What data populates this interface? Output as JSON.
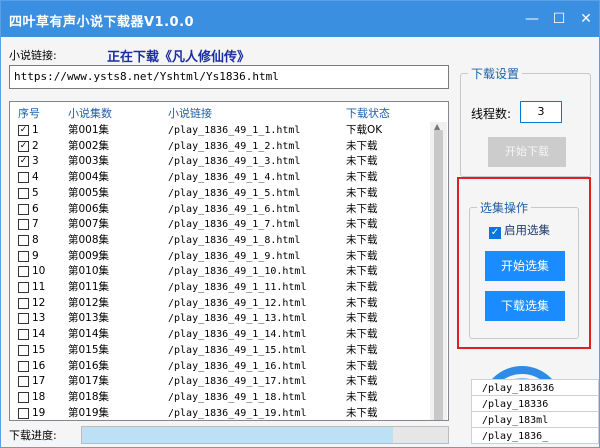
{
  "app": {
    "title": "四叶草有声小说下载器V1.0.0"
  },
  "window_controls": {
    "minimize": "—",
    "maximize": "☐",
    "close": "✕"
  },
  "link": {
    "label": "小说链接:",
    "status": "正在下载《凡人修仙传》",
    "url": "https://www.ysts8.net/Yshtml/Ys1836.html"
  },
  "table": {
    "headers": [
      "序号",
      "小说集数",
      "小说链接",
      "下载状态"
    ],
    "rows": [
      {
        "checked": true,
        "no": "1",
        "ep": "第001集",
        "link": "/play_1836_49_1_1.html",
        "status": "下载OK"
      },
      {
        "checked": true,
        "no": "2",
        "ep": "第002集",
        "link": "/play_1836_49_1_2.html",
        "status": "未下载"
      },
      {
        "checked": true,
        "no": "3",
        "ep": "第003集",
        "link": "/play_1836_49_1_3.html",
        "status": "未下载"
      },
      {
        "checked": false,
        "no": "4",
        "ep": "第004集",
        "link": "/play_1836_49_1_4.html",
        "status": "未下载"
      },
      {
        "checked": false,
        "no": "5",
        "ep": "第005集",
        "link": "/play_1836_49_1_5.html",
        "status": "未下载"
      },
      {
        "checked": false,
        "no": "6",
        "ep": "第006集",
        "link": "/play_1836_49_1_6.html",
        "status": "未下载"
      },
      {
        "checked": false,
        "no": "7",
        "ep": "第007集",
        "link": "/play_1836_49_1_7.html",
        "status": "未下载"
      },
      {
        "checked": false,
        "no": "8",
        "ep": "第008集",
        "link": "/play_1836_49_1_8.html",
        "status": "未下载"
      },
      {
        "checked": false,
        "no": "9",
        "ep": "第009集",
        "link": "/play_1836_49_1_9.html",
        "status": "未下载"
      },
      {
        "checked": false,
        "no": "10",
        "ep": "第010集",
        "link": "/play_1836_49_1_10.html",
        "status": "未下载"
      },
      {
        "checked": false,
        "no": "11",
        "ep": "第011集",
        "link": "/play_1836_49_1_11.html",
        "status": "未下载"
      },
      {
        "checked": false,
        "no": "12",
        "ep": "第012集",
        "link": "/play_1836_49_1_12.html",
        "status": "未下载"
      },
      {
        "checked": false,
        "no": "13",
        "ep": "第013集",
        "link": "/play_1836_49_1_13.html",
        "status": "未下载"
      },
      {
        "checked": false,
        "no": "14",
        "ep": "第014集",
        "link": "/play_1836_49_1_14.html",
        "status": "未下载"
      },
      {
        "checked": false,
        "no": "15",
        "ep": "第015集",
        "link": "/play_1836_49_1_15.html",
        "status": "未下载"
      },
      {
        "checked": false,
        "no": "16",
        "ep": "第016集",
        "link": "/play_1836_49_1_16.html",
        "status": "未下载"
      },
      {
        "checked": false,
        "no": "17",
        "ep": "第017集",
        "link": "/play_1836_49_1_17.html",
        "status": "未下载"
      },
      {
        "checked": false,
        "no": "18",
        "ep": "第018集",
        "link": "/play_1836_49_1_18.html",
        "status": "未下载"
      },
      {
        "checked": false,
        "no": "19",
        "ep": "第019集",
        "link": "/play_1836_49_1_19.html",
        "status": "未下载"
      }
    ]
  },
  "progress": {
    "label": "下载进度:",
    "fraction": 0.85
  },
  "settings": {
    "title": "下载设置",
    "thread_label": "线程数:",
    "thread_value": "3",
    "start_download": "开始下载"
  },
  "selection": {
    "title": "选集操作",
    "enable_label": "启用选集",
    "start_select": "开始选集",
    "download_select": "下载选集"
  },
  "popup_list": [
    "/play_183636",
    "/play_18336",
    "/play_183ml",
    "/play_1836_"
  ],
  "colors": {
    "titlebar": "#3b8fe0",
    "accent": "#1a8cff",
    "highlight_box": "#e02020"
  }
}
